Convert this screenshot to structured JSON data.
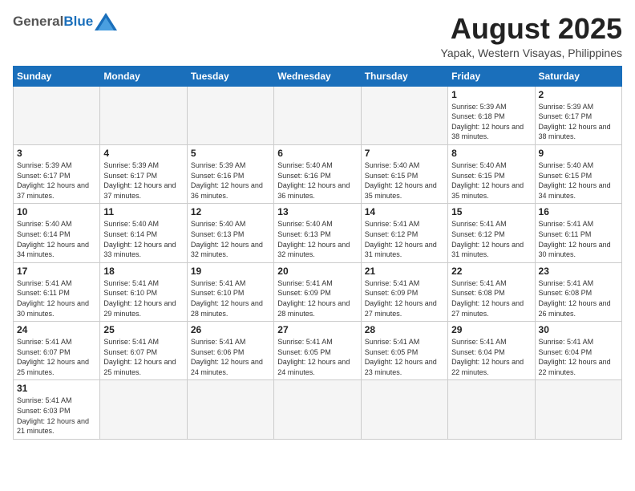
{
  "header": {
    "logo_general": "General",
    "logo_blue": "Blue",
    "month_title": "August 2025",
    "subtitle": "Yapak, Western Visayas, Philippines"
  },
  "weekdays": [
    "Sunday",
    "Monday",
    "Tuesday",
    "Wednesday",
    "Thursday",
    "Friday",
    "Saturday"
  ],
  "weeks": [
    [
      {
        "day": "",
        "info": ""
      },
      {
        "day": "",
        "info": ""
      },
      {
        "day": "",
        "info": ""
      },
      {
        "day": "",
        "info": ""
      },
      {
        "day": "",
        "info": ""
      },
      {
        "day": "1",
        "info": "Sunrise: 5:39 AM\nSunset: 6:18 PM\nDaylight: 12 hours\nand 38 minutes."
      },
      {
        "day": "2",
        "info": "Sunrise: 5:39 AM\nSunset: 6:17 PM\nDaylight: 12 hours\nand 38 minutes."
      }
    ],
    [
      {
        "day": "3",
        "info": "Sunrise: 5:39 AM\nSunset: 6:17 PM\nDaylight: 12 hours\nand 37 minutes."
      },
      {
        "day": "4",
        "info": "Sunrise: 5:39 AM\nSunset: 6:17 PM\nDaylight: 12 hours\nand 37 minutes."
      },
      {
        "day": "5",
        "info": "Sunrise: 5:39 AM\nSunset: 6:16 PM\nDaylight: 12 hours\nand 36 minutes."
      },
      {
        "day": "6",
        "info": "Sunrise: 5:40 AM\nSunset: 6:16 PM\nDaylight: 12 hours\nand 36 minutes."
      },
      {
        "day": "7",
        "info": "Sunrise: 5:40 AM\nSunset: 6:15 PM\nDaylight: 12 hours\nand 35 minutes."
      },
      {
        "day": "8",
        "info": "Sunrise: 5:40 AM\nSunset: 6:15 PM\nDaylight: 12 hours\nand 35 minutes."
      },
      {
        "day": "9",
        "info": "Sunrise: 5:40 AM\nSunset: 6:15 PM\nDaylight: 12 hours\nand 34 minutes."
      }
    ],
    [
      {
        "day": "10",
        "info": "Sunrise: 5:40 AM\nSunset: 6:14 PM\nDaylight: 12 hours\nand 34 minutes."
      },
      {
        "day": "11",
        "info": "Sunrise: 5:40 AM\nSunset: 6:14 PM\nDaylight: 12 hours\nand 33 minutes."
      },
      {
        "day": "12",
        "info": "Sunrise: 5:40 AM\nSunset: 6:13 PM\nDaylight: 12 hours\nand 32 minutes."
      },
      {
        "day": "13",
        "info": "Sunrise: 5:40 AM\nSunset: 6:13 PM\nDaylight: 12 hours\nand 32 minutes."
      },
      {
        "day": "14",
        "info": "Sunrise: 5:41 AM\nSunset: 6:12 PM\nDaylight: 12 hours\nand 31 minutes."
      },
      {
        "day": "15",
        "info": "Sunrise: 5:41 AM\nSunset: 6:12 PM\nDaylight: 12 hours\nand 31 minutes."
      },
      {
        "day": "16",
        "info": "Sunrise: 5:41 AM\nSunset: 6:11 PM\nDaylight: 12 hours\nand 30 minutes."
      }
    ],
    [
      {
        "day": "17",
        "info": "Sunrise: 5:41 AM\nSunset: 6:11 PM\nDaylight: 12 hours\nand 30 minutes."
      },
      {
        "day": "18",
        "info": "Sunrise: 5:41 AM\nSunset: 6:10 PM\nDaylight: 12 hours\nand 29 minutes."
      },
      {
        "day": "19",
        "info": "Sunrise: 5:41 AM\nSunset: 6:10 PM\nDaylight: 12 hours\nand 28 minutes."
      },
      {
        "day": "20",
        "info": "Sunrise: 5:41 AM\nSunset: 6:09 PM\nDaylight: 12 hours\nand 28 minutes."
      },
      {
        "day": "21",
        "info": "Sunrise: 5:41 AM\nSunset: 6:09 PM\nDaylight: 12 hours\nand 27 minutes."
      },
      {
        "day": "22",
        "info": "Sunrise: 5:41 AM\nSunset: 6:08 PM\nDaylight: 12 hours\nand 27 minutes."
      },
      {
        "day": "23",
        "info": "Sunrise: 5:41 AM\nSunset: 6:08 PM\nDaylight: 12 hours\nand 26 minutes."
      }
    ],
    [
      {
        "day": "24",
        "info": "Sunrise: 5:41 AM\nSunset: 6:07 PM\nDaylight: 12 hours\nand 25 minutes."
      },
      {
        "day": "25",
        "info": "Sunrise: 5:41 AM\nSunset: 6:07 PM\nDaylight: 12 hours\nand 25 minutes."
      },
      {
        "day": "26",
        "info": "Sunrise: 5:41 AM\nSunset: 6:06 PM\nDaylight: 12 hours\nand 24 minutes."
      },
      {
        "day": "27",
        "info": "Sunrise: 5:41 AM\nSunset: 6:05 PM\nDaylight: 12 hours\nand 24 minutes."
      },
      {
        "day": "28",
        "info": "Sunrise: 5:41 AM\nSunset: 6:05 PM\nDaylight: 12 hours\nand 23 minutes."
      },
      {
        "day": "29",
        "info": "Sunrise: 5:41 AM\nSunset: 6:04 PM\nDaylight: 12 hours\nand 22 minutes."
      },
      {
        "day": "30",
        "info": "Sunrise: 5:41 AM\nSunset: 6:04 PM\nDaylight: 12 hours\nand 22 minutes."
      }
    ],
    [
      {
        "day": "31",
        "info": "Sunrise: 5:41 AM\nSunset: 6:03 PM\nDaylight: 12 hours\nand 21 minutes."
      },
      {
        "day": "",
        "info": ""
      },
      {
        "day": "",
        "info": ""
      },
      {
        "day": "",
        "info": ""
      },
      {
        "day": "",
        "info": ""
      },
      {
        "day": "",
        "info": ""
      },
      {
        "day": "",
        "info": ""
      }
    ]
  ]
}
